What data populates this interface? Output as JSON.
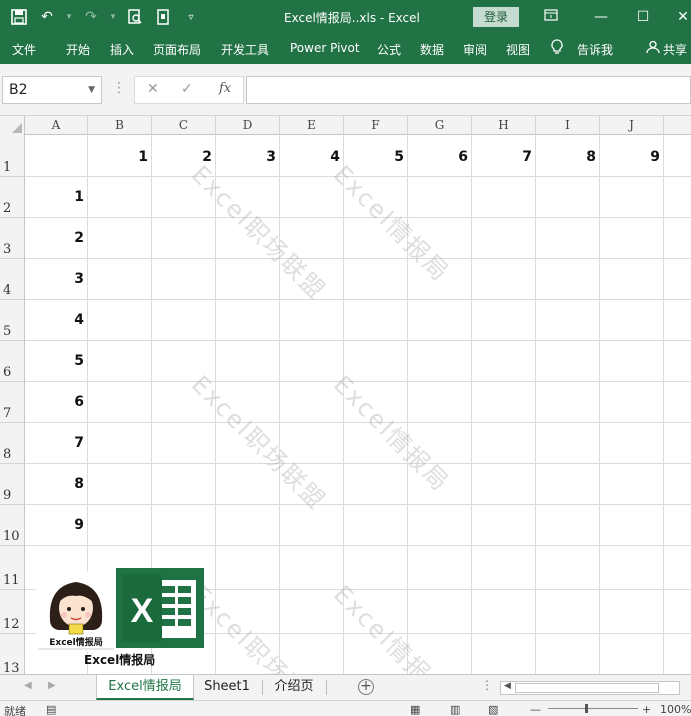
{
  "titlebar": {
    "title": "Excel情报局..xls  -  Excel",
    "login": "登录"
  },
  "ribbon": {
    "tabs": [
      "文件",
      "开始",
      "插入",
      "页面布局",
      "开发工具",
      "Power Pivot",
      "公式",
      "数据",
      "审阅",
      "视图",
      "告诉我",
      "共享"
    ]
  },
  "formula": {
    "namebox": "B2",
    "value": ""
  },
  "grid": {
    "columns": [
      "A",
      "B",
      "C",
      "D",
      "E",
      "F",
      "G",
      "H",
      "I",
      "J"
    ],
    "rows": [
      "1",
      "2",
      "3",
      "4",
      "5",
      "6",
      "7",
      "8",
      "9",
      "10",
      "11",
      "12",
      "13"
    ],
    "row1_values": [
      "1",
      "2",
      "3",
      "4",
      "5",
      "6",
      "7",
      "8",
      "9"
    ],
    "colA_values": [
      "1",
      "2",
      "3",
      "4",
      "5",
      "6",
      "7",
      "8",
      "9"
    ]
  },
  "watermarks": [
    "Excel职场联盟",
    "Excel情报局"
  ],
  "pictures": {
    "avatar_label": "Excel情报局",
    "caption": "Excel情报局"
  },
  "sheets": [
    "Excel情报局",
    "Sheet1",
    "介绍页"
  ],
  "status": {
    "ready": "就绪",
    "zoom": "100%"
  }
}
